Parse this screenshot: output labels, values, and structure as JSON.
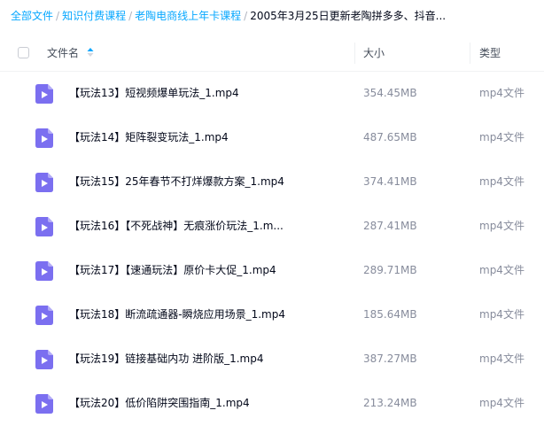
{
  "breadcrumb": {
    "items": [
      "全部文件",
      "知识付费课程",
      "老陶电商线上年卡课程"
    ],
    "current": "2005年3月25日更新老陶拼多多、抖音...",
    "separator": "/"
  },
  "table": {
    "headers": {
      "name": "文件名",
      "size": "大小",
      "type": "类型"
    },
    "rows": [
      {
        "name": "【玩法13】短视频爆单玩法_1.mp4",
        "size": "354.45MB",
        "type": "mp4文件"
      },
      {
        "name": "【玩法14】矩阵裂变玩法_1.mp4",
        "size": "487.65MB",
        "type": "mp4文件"
      },
      {
        "name": "【玩法15】25年春节不打烊爆款方案_1.mp4",
        "size": "374.41MB",
        "type": "mp4文件"
      },
      {
        "name": "【玩法16】【不死战神】无痕涨价玩法_1.m...",
        "size": "287.41MB",
        "type": "mp4文件"
      },
      {
        "name": "【玩法17】【速通玩法】原价卡大促_1.mp4",
        "size": "289.71MB",
        "type": "mp4文件"
      },
      {
        "name": "【玩法18】断流疏通器-瞬烧应用场景_1.mp4",
        "size": "185.64MB",
        "type": "mp4文件"
      },
      {
        "name": "【玩法19】链接基础内功 进阶版_1.mp4",
        "size": "387.27MB",
        "type": "mp4文件"
      },
      {
        "name": "【玩法20】低价陷阱突围指南_1.mp4",
        "size": "213.24MB",
        "type": "mp4文件"
      }
    ]
  },
  "icons": {
    "file": "video-file-icon",
    "sort": "sort-icon"
  },
  "colors": {
    "link": "#06a7ff",
    "video_icon": "#7b6ff0",
    "secondary_text": "#878c9c"
  }
}
